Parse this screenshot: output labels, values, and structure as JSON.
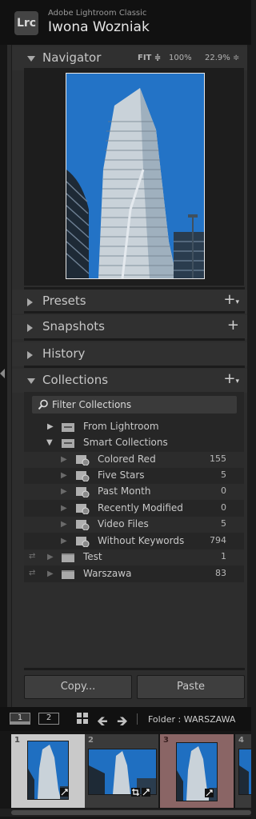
{
  "app": {
    "logo": "Lrc",
    "name": "Adobe Lightroom Classic",
    "user": "Iwona Wozniak"
  },
  "navigator": {
    "title": "Navigator",
    "fit": "FIT ≑",
    "zoom_100": "100%",
    "zoom_custom": "22.9% ≑"
  },
  "panels": {
    "presets": "Presets",
    "snapshots": "Snapshots",
    "history": "History",
    "collections": "Collections"
  },
  "collections": {
    "filter_placeholder": "Filter Collections",
    "sets": [
      {
        "name": "From Lightroom"
      },
      {
        "name": "Smart Collections"
      }
    ],
    "smart": [
      {
        "name": "Colored Red",
        "count": "155"
      },
      {
        "name": "Five Stars",
        "count": "5"
      },
      {
        "name": "Past Month",
        "count": "0"
      },
      {
        "name": "Recently Modified",
        "count": "0"
      },
      {
        "name": "Video Files",
        "count": "5"
      },
      {
        "name": "Without Keywords",
        "count": "794"
      }
    ],
    "regular": [
      {
        "name": "Test",
        "count": "1"
      },
      {
        "name": "Warszawa",
        "count": "83"
      }
    ]
  },
  "buttons": {
    "copy": "Copy...",
    "paste": "Paste"
  },
  "filmstrip_toolbar": {
    "screen1": "1",
    "screen2": "2",
    "folder": "Folder : WARSZAWA"
  },
  "filmstrip": {
    "cells": [
      {
        "number": "1",
        "color": "#c9c9c9"
      },
      {
        "number": "2",
        "color": "#3a3a3a"
      },
      {
        "number": "3",
        "color": "#8a6565"
      },
      {
        "number": "4",
        "color": "#3a3a3a"
      }
    ]
  },
  "colors": {
    "sky": "#1f6fc1",
    "panel_bg": "#2d2d2d",
    "accent_text": "#c8c8c8"
  }
}
